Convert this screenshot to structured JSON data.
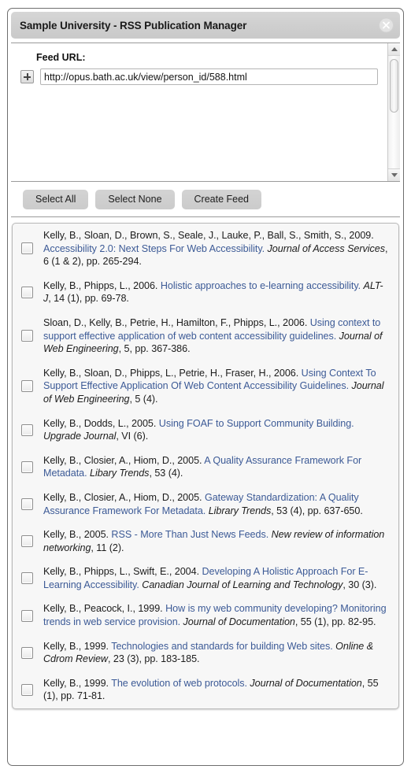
{
  "window": {
    "title": "Sample University - RSS Publication Manager",
    "close_icon": "close-circle-icon"
  },
  "feed": {
    "label": "Feed URL:",
    "expand_icon": "plus-expand-icon",
    "url_value": "http://opus.bath.ac.uk/view/person_id/588.html",
    "url_placeholder": "Feed URL"
  },
  "toolbar": {
    "select_all_label": "Select All",
    "select_none_label": "Select None",
    "create_feed_label": "Create Feed"
  },
  "scrollbar": {
    "up_icon": "scroll-up-arrow-icon",
    "down_icon": "scroll-down-arrow-icon",
    "thumb": "scrollbar-thumb"
  },
  "publications": [
    {
      "parts": [
        {
          "t": "Kelly, B., Sloan, D., Brown, S., Seale, J., Lauke, P., Ball, S., Smith, S., 2009. ",
          "s": "plain"
        },
        {
          "t": "Accessibility 2.0: Next Steps For Web Accessibility.",
          "s": "link"
        },
        {
          "t": " ",
          "s": "plain"
        },
        {
          "t": "Journal of Access Services",
          "s": "journal"
        },
        {
          "t": ", 6 (1 & 2), pp. 265-294.",
          "s": "plain"
        }
      ]
    },
    {
      "parts": [
        {
          "t": "Kelly, B., Phipps, L., 2006. ",
          "s": "plain"
        },
        {
          "t": "Holistic approaches to e-learning accessibility.",
          "s": "link"
        },
        {
          "t": " ",
          "s": "plain"
        },
        {
          "t": "ALT-J",
          "s": "journal"
        },
        {
          "t": ", 14 (1), pp. 69-78.",
          "s": "plain"
        }
      ]
    },
    {
      "parts": [
        {
          "t": "Sloan, D., Kelly, B., Petrie, H., Hamilton, F., Phipps, L., 2006. ",
          "s": "plain"
        },
        {
          "t": "Using context to support effective application of web content accessibility guidelines.",
          "s": "link"
        },
        {
          "t": " ",
          "s": "plain"
        },
        {
          "t": "Journal of Web Engineering",
          "s": "journal"
        },
        {
          "t": ", 5, pp. 367-386.",
          "s": "plain"
        }
      ]
    },
    {
      "parts": [
        {
          "t": "Kelly, B., Sloan, D., Phipps, L., Petrie, H., Fraser, H., 2006. ",
          "s": "plain"
        },
        {
          "t": "Using Context To Support Effective Application Of Web Content Accessibility Guidelines.",
          "s": "link"
        },
        {
          "t": " ",
          "s": "plain"
        },
        {
          "t": "Journal of Web Engineering",
          "s": "journal"
        },
        {
          "t": ", 5 (4).",
          "s": "plain"
        }
      ]
    },
    {
      "parts": [
        {
          "t": "Kelly, B., Dodds, L., 2005. ",
          "s": "plain"
        },
        {
          "t": "Using FOAF to Support Community Building.",
          "s": "link"
        },
        {
          "t": " ",
          "s": "plain"
        },
        {
          "t": "Upgrade Journal",
          "s": "journal"
        },
        {
          "t": ", VI (6).",
          "s": "plain"
        }
      ]
    },
    {
      "parts": [
        {
          "t": "Kelly, B., Closier, A., Hiom, D., 2005. ",
          "s": "plain"
        },
        {
          "t": "A Quality Assurance Framework For Metadata.",
          "s": "link"
        },
        {
          "t": " ",
          "s": "plain"
        },
        {
          "t": "Libary Trends",
          "s": "journal"
        },
        {
          "t": ", 53 (4).",
          "s": "plain"
        }
      ]
    },
    {
      "parts": [
        {
          "t": "Kelly, B., Closier, A., Hiom, D., 2005. ",
          "s": "plain"
        },
        {
          "t": "Gateway Standardization: A Quality Assurance Framework For Metadata.",
          "s": "link"
        },
        {
          "t": " ",
          "s": "plain"
        },
        {
          "t": "Library Trends",
          "s": "journal"
        },
        {
          "t": ", 53 (4), pp. 637-650.",
          "s": "plain"
        }
      ]
    },
    {
      "parts": [
        {
          "t": "Kelly, B., 2005. ",
          "s": "plain"
        },
        {
          "t": "RSS - More Than Just News Feeds.",
          "s": "link"
        },
        {
          "t": " ",
          "s": "plain"
        },
        {
          "t": "New review of information networking",
          "s": "journal"
        },
        {
          "t": ", 11 (2).",
          "s": "plain"
        }
      ]
    },
    {
      "parts": [
        {
          "t": "Kelly, B., Phipps, L., Swift, E., 2004. ",
          "s": "plain"
        },
        {
          "t": "Developing A Holistic Approach For E-Learning Accessibility.",
          "s": "link"
        },
        {
          "t": " ",
          "s": "plain"
        },
        {
          "t": "Canadian Journal of Learning and Technology",
          "s": "journal"
        },
        {
          "t": ", 30 (3).",
          "s": "plain"
        }
      ]
    },
    {
      "parts": [
        {
          "t": "Kelly, B., Peacock, I., 1999. ",
          "s": "plain"
        },
        {
          "t": "How is my web community developing? Monitoring trends in web service provision.",
          "s": "link"
        },
        {
          "t": " ",
          "s": "plain"
        },
        {
          "t": "Journal of Documentation",
          "s": "journal"
        },
        {
          "t": ", 55 (1), pp. 82-95.",
          "s": "plain"
        }
      ]
    },
    {
      "parts": [
        {
          "t": "Kelly, B., 1999. ",
          "s": "plain"
        },
        {
          "t": "Technologies and standards for building Web sites.",
          "s": "link"
        },
        {
          "t": " ",
          "s": "plain"
        },
        {
          "t": "Online & Cdrom Review",
          "s": "journal"
        },
        {
          "t": ", 23 (3), pp. 183-185.",
          "s": "plain"
        }
      ]
    },
    {
      "parts": [
        {
          "t": "Kelly, B., 1999. ",
          "s": "plain"
        },
        {
          "t": "The evolution of web protocols.",
          "s": "link"
        },
        {
          "t": " ",
          "s": "plain"
        },
        {
          "t": "Journal of Documentation",
          "s": "journal"
        },
        {
          "t": ", 55 (1), pp. 71-81.",
          "s": "plain"
        }
      ]
    }
  ],
  "colors": {
    "link": "#3c5a96",
    "titlebar": "#d1d1d1",
    "list_bg": "#f7f7f7",
    "window_border": "#6e6e6e"
  }
}
